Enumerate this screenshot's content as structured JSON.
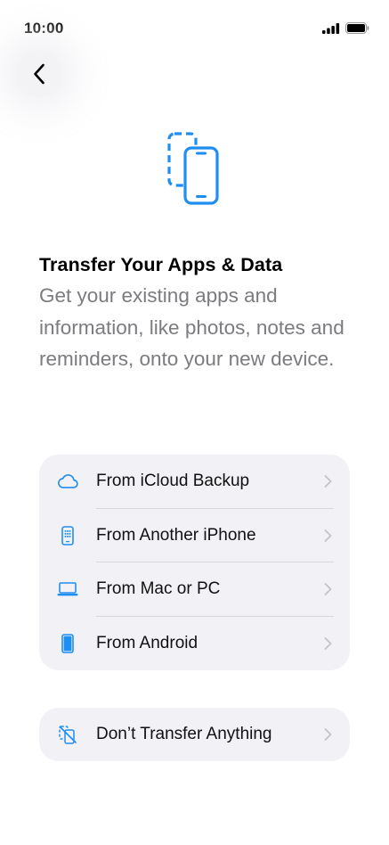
{
  "status_bar": {
    "time": "10:00"
  },
  "colors": {
    "accent": "#1f8ef1",
    "chevron": "#c4c4c8",
    "subtitle": "#7b7b80",
    "group_bg": "#f1f1f6"
  },
  "header": {
    "back_icon": "chevron-left-icon",
    "hero_icon": "two-phones-transfer-icon"
  },
  "content": {
    "title": "Transfer Your Apps & Data",
    "subtitle": "Get your existing apps and information, like photos, notes and reminders, onto your new device."
  },
  "options": [
    {
      "label": "From iCloud Backup",
      "icon": "icloud-icon"
    },
    {
      "label": "From Another iPhone",
      "icon": "iphone-icon"
    },
    {
      "label": "From Mac or PC",
      "icon": "laptop-icon"
    },
    {
      "label": "From Android",
      "icon": "android-phone-icon"
    }
  ],
  "skip_option": {
    "label": "Don’t Transfer Anything",
    "icon": "no-transfer-icon"
  }
}
